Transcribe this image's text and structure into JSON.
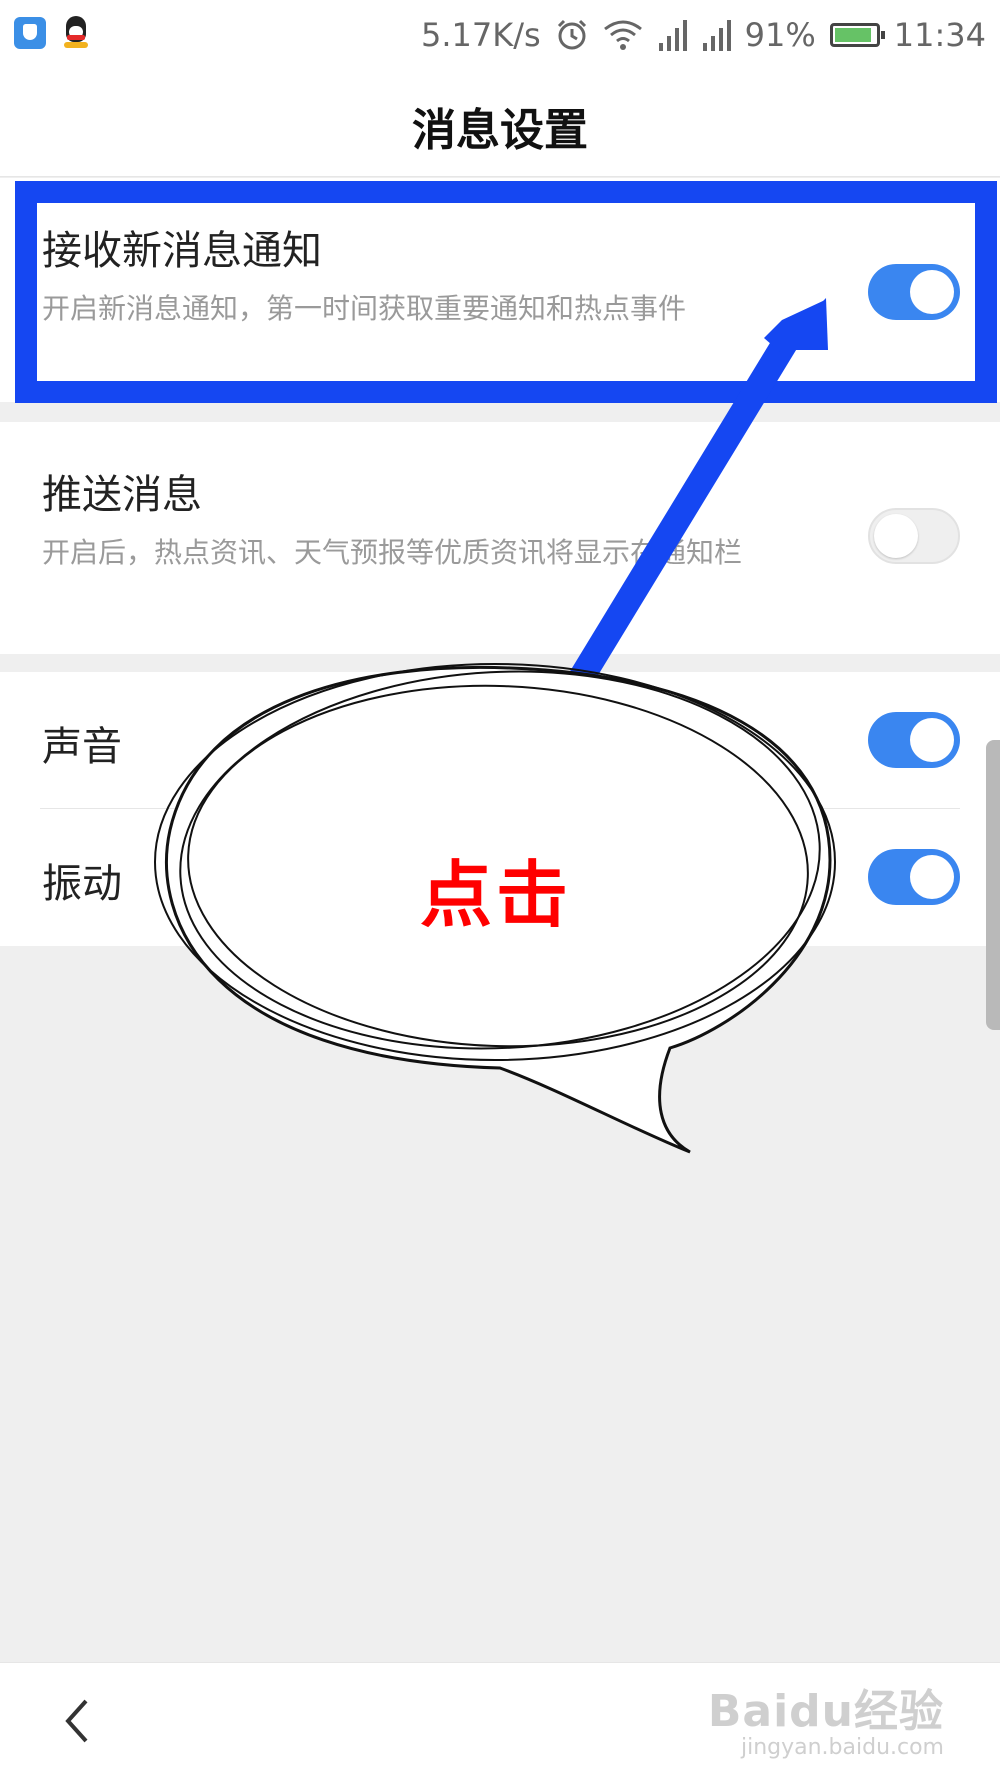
{
  "status_bar": {
    "net_speed": "5.17K/s",
    "battery": "91%",
    "battery_level": 0.91,
    "time": "11:34",
    "icons": [
      "shield-icon",
      "qq-penguin-icon",
      "alarm-icon",
      "wifi-icon",
      "signal-icon",
      "battery-icon"
    ]
  },
  "header": {
    "title": "消息设置"
  },
  "settings": [
    {
      "title": "接收新消息通知",
      "desc": "开启新消息通知，第一时间获取重要通知和热点事件",
      "enabled": true
    },
    {
      "title": "推送消息",
      "desc": "开启后，热点资讯、天气预报等优质资讯将显示在通知栏",
      "enabled": false
    },
    {
      "title": "声音",
      "enabled": true
    },
    {
      "title": "振动",
      "enabled": true
    }
  ],
  "annotation": {
    "bubble_text": "点击",
    "highlight_color": "#1547f2",
    "arrow_color": "#1547f2",
    "text_color": "#ff0000"
  },
  "footer": {
    "watermark_main": "Baidu经验",
    "watermark_sub": "jingyan.baidu.com"
  },
  "colors": {
    "toggle_on": "#3a86f0",
    "toggle_off": "#efefef",
    "background": "#efefef"
  }
}
